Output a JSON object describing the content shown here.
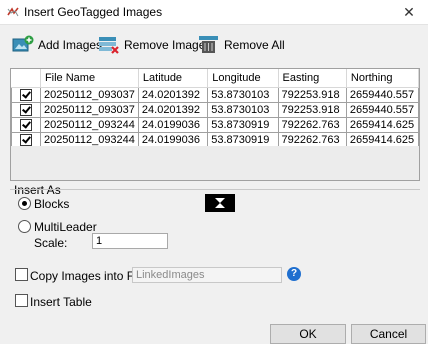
{
  "window": {
    "title": "Insert GeoTagged Images"
  },
  "toolbar": {
    "add_label": "Add Images",
    "remove_label": "Remove Image",
    "remove_all_label": "Remove All"
  },
  "table": {
    "columns": [
      "File Name",
      "Latitude",
      "Longitude",
      "Easting",
      "Northing"
    ],
    "rows": [
      {
        "checked": true,
        "file": "20250112_093037",
        "lat": "24.0201392",
        "lon": "53.8730103",
        "easting": "792253.918",
        "northing": "2659440.557"
      },
      {
        "checked": true,
        "file": "20250112_093037",
        "lat": "24.0201392",
        "lon": "53.8730103",
        "easting": "792253.918",
        "northing": "2659440.557"
      },
      {
        "checked": true,
        "file": "20250112_093244",
        "lat": "24.0199036",
        "lon": "53.8730919",
        "easting": "792262.763",
        "northing": "2659414.625"
      },
      {
        "checked": true,
        "file": "20250112_093244",
        "lat": "24.0199036",
        "lon": "53.8730919",
        "easting": "792262.763",
        "northing": "2659414.625"
      }
    ]
  },
  "insert_as": {
    "group_label": "Insert As",
    "blocks_label": "Blocks",
    "multileader_label": "MultiLeader",
    "selected": "Blocks",
    "scale_label": "Scale:",
    "scale_value": "1"
  },
  "copy_images": {
    "label": "Copy Images into Folder",
    "checked": false,
    "folder_placeholder": "LinkedImages"
  },
  "insert_table": {
    "label": "Insert Table",
    "checked": false
  },
  "buttons": {
    "ok": "OK",
    "cancel": "Cancel"
  },
  "colors": {
    "accent": "#1f6fcf",
    "remove_red": "#d9232d",
    "toolbar_teal": "#3a8fb7"
  }
}
